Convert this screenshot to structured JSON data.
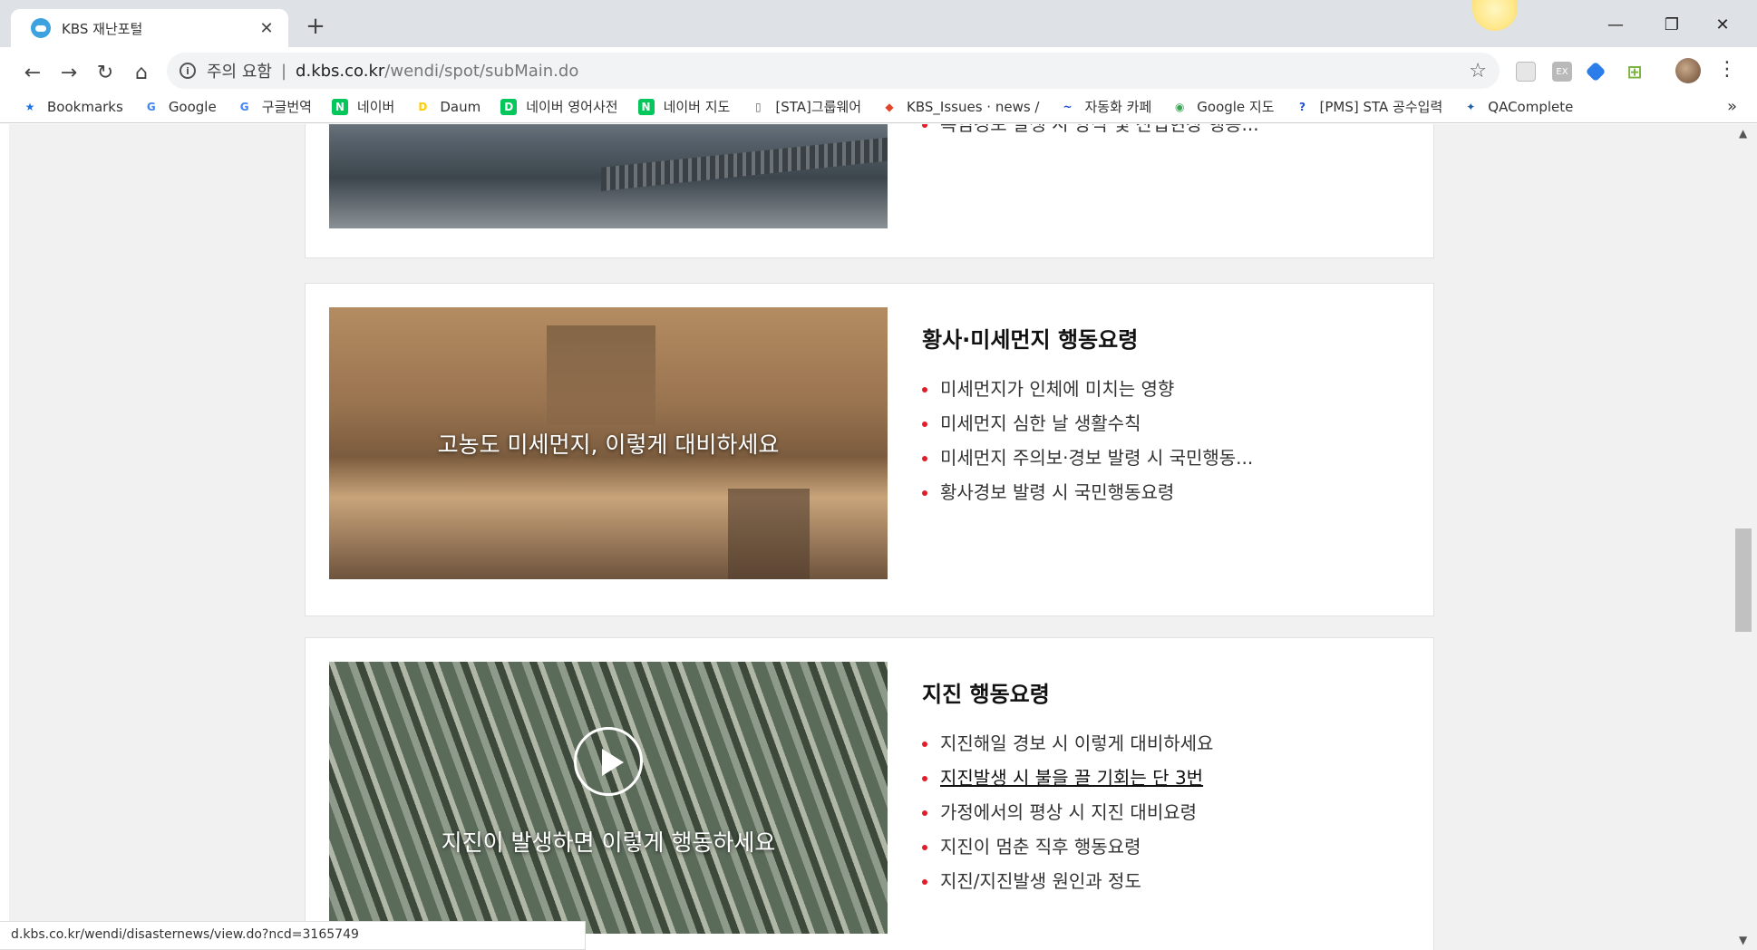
{
  "tab": {
    "title": "KBS 재난포털",
    "close": "✕"
  },
  "newtab": "+",
  "window_controls": {
    "minimize": "—",
    "restore": "❐",
    "close": "✕"
  },
  "nav": {
    "back": "←",
    "forward": "→",
    "reload": "↻",
    "home": "⌂"
  },
  "omnibox": {
    "security_label": "주의 요함",
    "separator": "|",
    "url_host": "d.kbs.co.kr",
    "url_path": "/wendi/spot/subMain.do",
    "star": "☆"
  },
  "bookmarks": [
    {
      "label": "Bookmarks",
      "icon": "star-icon",
      "color": "#1a73e8"
    },
    {
      "label": "Google",
      "icon": "google-icon",
      "color": "#4285f4"
    },
    {
      "label": "구글번역",
      "icon": "translate-icon",
      "color": "#4285f4"
    },
    {
      "label": "네이버",
      "icon": "naver-icon",
      "color": "#03c75a"
    },
    {
      "label": "Daum",
      "icon": "daum-icon",
      "color": "#ffcd00"
    },
    {
      "label": "네이버 영어사전",
      "icon": "dict-icon",
      "color": "#03c75a"
    },
    {
      "label": "네이버 지도",
      "icon": "naver-icon",
      "color": "#03c75a"
    },
    {
      "label": "[STA]그룹웨어",
      "icon": "page-icon",
      "color": "#666666"
    },
    {
      "label": "KBS_Issues · news / ",
      "icon": "gitlab-icon",
      "color": "#e24329"
    },
    {
      "label": "자동화 카페",
      "icon": "cafe-icon",
      "color": "#1d4ed8"
    },
    {
      "label": "Google 지도",
      "icon": "maps-icon",
      "color": "#34a853"
    },
    {
      "label": "[PMS] STA 공수입력",
      "icon": "pms-icon",
      "color": "#1d4ed8"
    },
    {
      "label": "QAComplete",
      "icon": "qa-icon",
      "color": "#1f5fa8"
    }
  ],
  "bookmarks_more": "»",
  "cards": [
    {
      "title": "",
      "caption": "",
      "items": [
        "폭염경보 발생 시 양식 및 산업현장 행동..."
      ]
    },
    {
      "title": "황사·미세먼지 행동요령",
      "caption": "고농도 미세먼지, 이렇게 대비하세요",
      "items": [
        "미세먼지가 인체에 미치는 영향",
        "미세먼지 심한 날 생활수칙",
        "미세먼지 주의보·경보 발령 시 국민행동...",
        "황사경보 발령 시 국민행동요령"
      ]
    },
    {
      "title": "지진 행동요령",
      "caption": "지진이 발생하면 이렇게 행동하세요",
      "items": [
        "지진해일 경보 시 이렇게 대비하세요",
        "지진발생 시 불을 끌 기회는 단 3번",
        "가정에서의 평상 시 지진 대비요령",
        "지진이 멈춘 직후 행동요령",
        "지진/지진발생 원인과 정도"
      ]
    }
  ],
  "status_url": "d.kbs.co.kr/wendi/disasternews/view.do?ncd=3165749"
}
